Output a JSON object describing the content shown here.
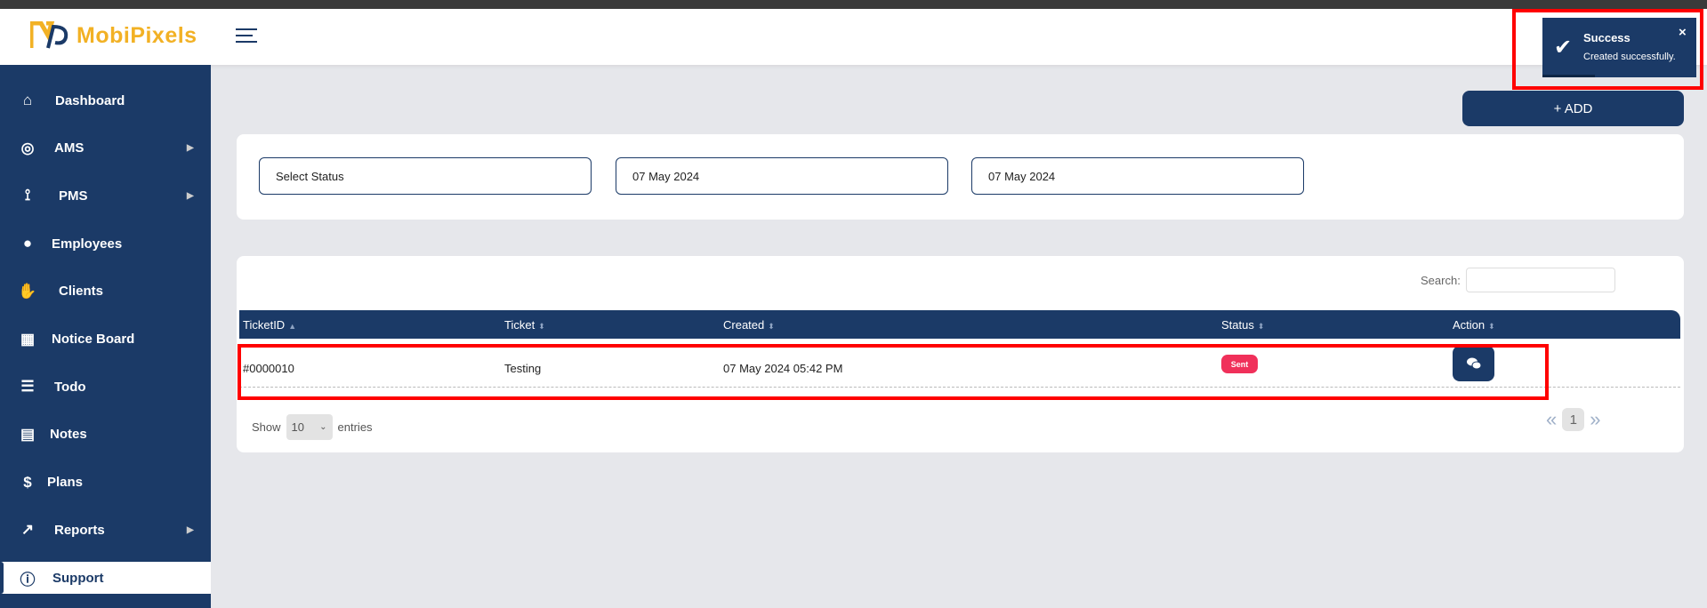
{
  "brand": {
    "name": "MobiPixels",
    "accent": "#f2b124",
    "primary": "#1b3a67"
  },
  "sidebar": {
    "items": [
      {
        "label": "Dashboard",
        "icon": "home-icon",
        "arrow": false
      },
      {
        "label": "AMS",
        "icon": "fingerprint-icon",
        "arrow": true
      },
      {
        "label": "PMS",
        "icon": "bezier-icon",
        "arrow": true
      },
      {
        "label": "Employees",
        "icon": "user-icon",
        "arrow": false
      },
      {
        "label": "Clients",
        "icon": "handshake-icon",
        "arrow": false
      },
      {
        "label": "Notice Board",
        "icon": "calendar-icon",
        "arrow": false
      },
      {
        "label": "Todo",
        "icon": "checklist-icon",
        "arrow": false
      },
      {
        "label": "Notes",
        "icon": "note-icon",
        "arrow": false
      },
      {
        "label": "Plans",
        "icon": "dollar-icon",
        "arrow": false
      },
      {
        "label": "Reports",
        "icon": "chart-line-icon",
        "arrow": true
      },
      {
        "label": "Support",
        "icon": "info-icon",
        "arrow": false,
        "active": true
      }
    ]
  },
  "toolbar": {
    "add_label": "+ ADD"
  },
  "filters": {
    "status": "Select Status",
    "from_date": "07 May 2024",
    "to_date": "07 May 2024"
  },
  "table": {
    "search_label": "Search:",
    "columns": [
      "TicketID",
      "Ticket",
      "Created",
      "Status",
      "Action"
    ],
    "rows": [
      {
        "id": "#0000010",
        "ticket": "Testing",
        "created": "07 May 2024 05:42 PM",
        "status": "Sent",
        "status_color": "#f0305a"
      }
    ],
    "show_label": "Show",
    "entries_value": "10",
    "entries_label": "entries",
    "pagination": {
      "prev": "«",
      "current": "1",
      "next": "»"
    }
  },
  "toast": {
    "title": "Success",
    "message": "Created successfully.",
    "close": "×",
    "icon": "check-icon"
  }
}
